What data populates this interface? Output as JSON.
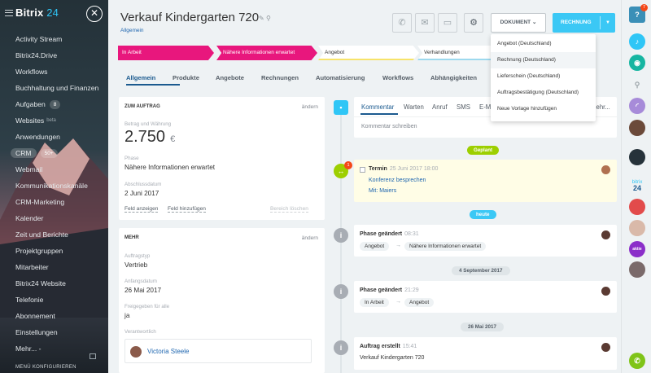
{
  "sidebar": {
    "logo_main": "Bitrix",
    "logo_num": "24",
    "items": [
      {
        "label": "Activity Stream"
      },
      {
        "label": "Bitrix24.Drive"
      },
      {
        "label": "Workflows"
      },
      {
        "label": "Buchhaltung und Finanzen"
      },
      {
        "label": "Aufgaben",
        "badge": "8"
      },
      {
        "label": "Websites",
        "beta": "beta"
      },
      {
        "label": "Anwendungen"
      },
      {
        "label": "CRM",
        "badge": "50+"
      },
      {
        "label": "Webmail"
      },
      {
        "label": "Kommunikationskanäle"
      },
      {
        "label": "CRM-Marketing"
      },
      {
        "label": "Kalender"
      },
      {
        "label": "Zeit und Berichte"
      },
      {
        "label": "Projektgruppen"
      },
      {
        "label": "Mitarbeiter"
      },
      {
        "label": "Bitrix24 Website"
      },
      {
        "label": "Telefonie"
      },
      {
        "label": "Abonnement"
      },
      {
        "label": "Einstellungen"
      },
      {
        "label": "Mehr... -"
      }
    ],
    "footer": "MENÜ KONFIGURIEREN"
  },
  "header": {
    "title": "Verkauf Kindergarten 720",
    "breadcrumb": "Allgemein",
    "document_button": "DOKUMENT",
    "invoice_button": "RECHNUNG"
  },
  "stages": [
    "In Arbeit",
    "Nähere Informationen erwartet",
    "Angebot",
    "Verhandlungen"
  ],
  "tabs": [
    "Allgemein",
    "Produkte",
    "Angebote",
    "Rechnungen",
    "Automatisierung",
    "Workflows",
    "Abhängigkeiten"
  ],
  "order_card": {
    "heading": "ZUM AUFTRAG",
    "edit": "ändern",
    "amount_label": "Betrag und Währung",
    "amount": "2.750",
    "currency": "€",
    "phase_label": "Phase",
    "phase": "Nähere Informationen erwartet",
    "close_label": "Abschlussdatum",
    "close_date": "2 Juni 2017",
    "show_field": "Feld anzeigen",
    "add_field": "Feld hinzufügen",
    "delete_section": "Bereich löschen"
  },
  "more_card": {
    "heading": "MEHR",
    "edit": "ändern",
    "type_label": "Auftragstyp",
    "type": "Vertrieb",
    "start_label": "Anfangsdatum",
    "start_date": "26 Mai 2017",
    "shared_label": "Freigegeben für alle",
    "shared": "ja",
    "responsible_label": "Verantwortlich",
    "responsible": "Victoria Steele"
  },
  "comm_tabs": [
    "Kommentar",
    "Warten",
    "Anruf",
    "SMS",
    "E-M",
    "Mehr..."
  ],
  "comment_placeholder": "Kommentar schreiben",
  "timeline": {
    "planned_label": "Geplant",
    "today_label": "heute",
    "termin": {
      "title": "Termin",
      "time": "25 Juni 2017 18:00",
      "subject": "Konferenz besprechen",
      "with": "Mit: Maiers",
      "badge": "1"
    },
    "phase1": {
      "title": "Phase geändert",
      "time": "08:31",
      "from": "Angebot",
      "to": "Nähere Informationen erwartet"
    },
    "date1": "4 September 2017",
    "phase2": {
      "title": "Phase geändert",
      "time": "21:29",
      "from": "In Arbeit",
      "to": "Angebot"
    },
    "date2": "26 Mai 2017",
    "created": {
      "title": "Auftrag erstellt",
      "time": "15:41",
      "text": "Verkauf Kindergarten 720"
    }
  },
  "dropdown": {
    "items": [
      "Angebot (Deutschland)",
      "Rechnung (Deutschland)",
      "Lieferschein (Deutschland)",
      "Auftragsbestätigung (Deutschland)",
      "Neue Vorlage hinzufügen"
    ]
  },
  "rightbar": {
    "help_badge": "7",
    "bitrix_label": "bitrix",
    "bitrix_num": "24",
    "aktie_label": "aktie"
  },
  "colors": {
    "accent": "#3bc8f5",
    "stage_active": "#e8177d",
    "planned": "#9dcf00"
  }
}
